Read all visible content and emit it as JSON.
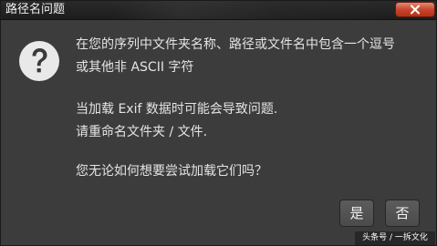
{
  "window": {
    "title": "路径名问题"
  },
  "message": {
    "line1": "在您的序列中文件夹名称、路径或文件名中包含一个逗号",
    "line2": "或其他非 ASCII 字符",
    "line3": "当加载 Exif 数据时可能会导致问题.",
    "line4": "请重命名文件夹 / 文件.",
    "line5": "您无论如何想要尝试加载它们吗？"
  },
  "buttons": {
    "yes_label": "是",
    "no_label": "否"
  },
  "watermark": {
    "text": "头条号 / 一拆文化"
  },
  "colors": {
    "close_button": "#c7452b",
    "dialog_background": "#3c3c3c",
    "text": "#e4e4e4"
  },
  "icons": {
    "dialog_icon": "question-icon",
    "close_icon": "close-icon"
  }
}
